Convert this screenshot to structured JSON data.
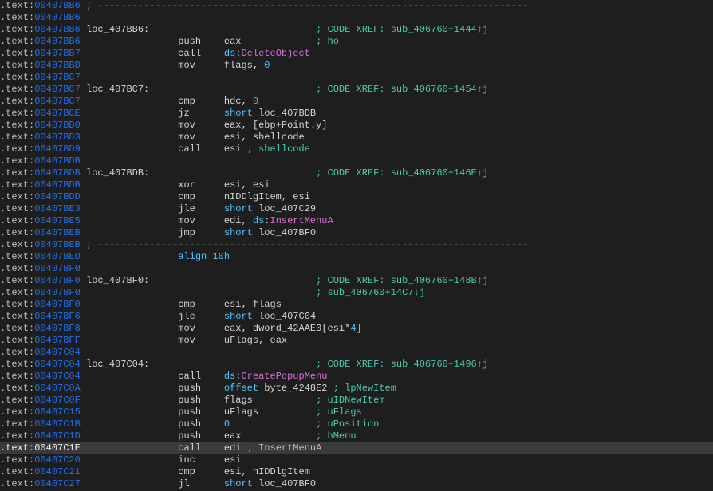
{
  "lines": [
    {
      "addr": "00407BB6",
      "segs": [
        {
          "c": "sep",
          "t": " ; ---------------------------------------------------------------------------"
        }
      ]
    },
    {
      "addr": "00407BB6",
      "segs": []
    },
    {
      "addr": "00407BB6",
      "segs": [
        {
          "c": "label",
          "t": " loc_407BB6"
        },
        {
          "c": "label",
          "t": ":"
        },
        {
          "c": "ident",
          "t": "                             "
        },
        {
          "c": "comment",
          "t": "; CODE XREF: sub_406760+1444"
        },
        {
          "c": "arrow",
          "t": "↑j"
        }
      ]
    },
    {
      "addr": "00407BB6",
      "segs": [
        {
          "c": "ident",
          "t": "                 "
        },
        {
          "c": "mnemonic",
          "t": "push"
        },
        {
          "c": "ident",
          "t": "    "
        },
        {
          "c": "reg",
          "t": "eax"
        },
        {
          "c": "ident",
          "t": "             "
        },
        {
          "c": "comment",
          "t": "; ho"
        }
      ]
    },
    {
      "addr": "00407BB7",
      "segs": [
        {
          "c": "ident",
          "t": "                 "
        },
        {
          "c": "mnemonic",
          "t": "call"
        },
        {
          "c": "ident",
          "t": "    "
        },
        {
          "c": "keyword",
          "t": "ds"
        },
        {
          "c": "ident",
          "t": ":"
        },
        {
          "c": "func",
          "t": "DeleteObject"
        }
      ]
    },
    {
      "addr": "00407BBD",
      "segs": [
        {
          "c": "ident",
          "t": "                 "
        },
        {
          "c": "mnemonic",
          "t": "mov"
        },
        {
          "c": "ident",
          "t": "     "
        },
        {
          "c": "ident",
          "t": "flags"
        },
        {
          "c": "ident",
          "t": ", "
        },
        {
          "c": "number",
          "t": "0"
        }
      ]
    },
    {
      "addr": "00407BC7",
      "segs": []
    },
    {
      "addr": "00407BC7",
      "segs": [
        {
          "c": "label",
          "t": " loc_407BC7"
        },
        {
          "c": "label",
          "t": ":"
        },
        {
          "c": "ident",
          "t": "                             "
        },
        {
          "c": "comment",
          "t": "; CODE XREF: sub_406760+1454"
        },
        {
          "c": "arrow",
          "t": "↑j"
        }
      ]
    },
    {
      "addr": "00407BC7",
      "segs": [
        {
          "c": "ident",
          "t": "                 "
        },
        {
          "c": "mnemonic",
          "t": "cmp"
        },
        {
          "c": "ident",
          "t": "     "
        },
        {
          "c": "ident",
          "t": "hdc"
        },
        {
          "c": "ident",
          "t": ", "
        },
        {
          "c": "number",
          "t": "0"
        }
      ]
    },
    {
      "addr": "00407BCE",
      "segs": [
        {
          "c": "ident",
          "t": "                 "
        },
        {
          "c": "mnemonic",
          "t": "jz"
        },
        {
          "c": "ident",
          "t": "      "
        },
        {
          "c": "short",
          "t": "short"
        },
        {
          "c": "ident",
          "t": " loc_407BDB"
        }
      ]
    },
    {
      "addr": "00407BD0",
      "segs": [
        {
          "c": "ident",
          "t": "                 "
        },
        {
          "c": "mnemonic",
          "t": "mov"
        },
        {
          "c": "ident",
          "t": "     "
        },
        {
          "c": "reg",
          "t": "eax"
        },
        {
          "c": "ident",
          "t": ", "
        },
        {
          "c": "ident",
          "t": "["
        },
        {
          "c": "reg",
          "t": "ebp"
        },
        {
          "c": "ident",
          "t": "+"
        },
        {
          "c": "ident",
          "t": "Point.y"
        },
        {
          "c": "ident",
          "t": "]"
        }
      ]
    },
    {
      "addr": "00407BD3",
      "segs": [
        {
          "c": "ident",
          "t": "                 "
        },
        {
          "c": "mnemonic",
          "t": "mov"
        },
        {
          "c": "ident",
          "t": "     "
        },
        {
          "c": "reg",
          "t": "esi"
        },
        {
          "c": "ident",
          "t": ", "
        },
        {
          "c": "ident",
          "t": "shellcode"
        }
      ]
    },
    {
      "addr": "00407BD9",
      "segs": [
        {
          "c": "ident",
          "t": "                 "
        },
        {
          "c": "mnemonic",
          "t": "call"
        },
        {
          "c": "ident",
          "t": "    "
        },
        {
          "c": "reg",
          "t": "esi"
        },
        {
          "c": "ident",
          "t": " "
        },
        {
          "c": "comment",
          "t": "; shellcode"
        }
      ]
    },
    {
      "addr": "00407BDB",
      "segs": []
    },
    {
      "addr": "00407BDB",
      "segs": [
        {
          "c": "label",
          "t": " loc_407BDB"
        },
        {
          "c": "label",
          "t": ":"
        },
        {
          "c": "ident",
          "t": "                             "
        },
        {
          "c": "comment",
          "t": "; CODE XREF: sub_406760+146E"
        },
        {
          "c": "arrow",
          "t": "↑j"
        }
      ]
    },
    {
      "addr": "00407BDB",
      "segs": [
        {
          "c": "ident",
          "t": "                 "
        },
        {
          "c": "mnemonic",
          "t": "xor"
        },
        {
          "c": "ident",
          "t": "     "
        },
        {
          "c": "reg",
          "t": "esi"
        },
        {
          "c": "ident",
          "t": ", "
        },
        {
          "c": "reg",
          "t": "esi"
        }
      ]
    },
    {
      "addr": "00407BDD",
      "segs": [
        {
          "c": "ident",
          "t": "                 "
        },
        {
          "c": "mnemonic",
          "t": "cmp"
        },
        {
          "c": "ident",
          "t": "     "
        },
        {
          "c": "ident",
          "t": "nIDDlgItem"
        },
        {
          "c": "ident",
          "t": ", "
        },
        {
          "c": "reg",
          "t": "esi"
        }
      ]
    },
    {
      "addr": "00407BE3",
      "segs": [
        {
          "c": "ident",
          "t": "                 "
        },
        {
          "c": "mnemonic",
          "t": "jle"
        },
        {
          "c": "ident",
          "t": "     "
        },
        {
          "c": "short",
          "t": "short"
        },
        {
          "c": "ident",
          "t": " loc_407C29"
        }
      ]
    },
    {
      "addr": "00407BE5",
      "segs": [
        {
          "c": "ident",
          "t": "                 "
        },
        {
          "c": "mnemonic",
          "t": "mov"
        },
        {
          "c": "ident",
          "t": "     "
        },
        {
          "c": "reg",
          "t": "edi"
        },
        {
          "c": "ident",
          "t": ", "
        },
        {
          "c": "keyword",
          "t": "ds"
        },
        {
          "c": "ident",
          "t": ":"
        },
        {
          "c": "func",
          "t": "InsertMenuA"
        }
      ]
    },
    {
      "addr": "00407BEB",
      "segs": [
        {
          "c": "ident",
          "t": "                 "
        },
        {
          "c": "mnemonic",
          "t": "jmp"
        },
        {
          "c": "ident",
          "t": "     "
        },
        {
          "c": "short",
          "t": "short"
        },
        {
          "c": "ident",
          "t": " loc_407BF0"
        }
      ]
    },
    {
      "addr": "00407BEB",
      "segs": [
        {
          "c": "sep",
          "t": " ; ---------------------------------------------------------------------------"
        }
      ]
    },
    {
      "addr": "00407BED",
      "segs": [
        {
          "c": "ident",
          "t": "                 "
        },
        {
          "c": "keyword",
          "t": "align "
        },
        {
          "c": "number",
          "t": "10h"
        }
      ]
    },
    {
      "addr": "00407BF0",
      "segs": []
    },
    {
      "addr": "00407BF0",
      "segs": [
        {
          "c": "label",
          "t": " loc_407BF0"
        },
        {
          "c": "label",
          "t": ":"
        },
        {
          "c": "ident",
          "t": "                             "
        },
        {
          "c": "comment",
          "t": "; CODE XREF: sub_406760+148B"
        },
        {
          "c": "arrow",
          "t": "↑j"
        }
      ]
    },
    {
      "addr": "00407BF0",
      "segs": [
        {
          "c": "ident",
          "t": "                                         "
        },
        {
          "c": "comment",
          "t": "; sub_406760+14C7"
        },
        {
          "c": "arrow",
          "t": "↓j"
        }
      ]
    },
    {
      "addr": "00407BF0",
      "segs": [
        {
          "c": "ident",
          "t": "                 "
        },
        {
          "c": "mnemonic",
          "t": "cmp"
        },
        {
          "c": "ident",
          "t": "     "
        },
        {
          "c": "reg",
          "t": "esi"
        },
        {
          "c": "ident",
          "t": ", "
        },
        {
          "c": "ident",
          "t": "flags"
        }
      ]
    },
    {
      "addr": "00407BF6",
      "segs": [
        {
          "c": "ident",
          "t": "                 "
        },
        {
          "c": "mnemonic",
          "t": "jle"
        },
        {
          "c": "ident",
          "t": "     "
        },
        {
          "c": "short",
          "t": "short"
        },
        {
          "c": "ident",
          "t": " loc_407C04"
        }
      ]
    },
    {
      "addr": "00407BF8",
      "segs": [
        {
          "c": "ident",
          "t": "                 "
        },
        {
          "c": "mnemonic",
          "t": "mov"
        },
        {
          "c": "ident",
          "t": "     "
        },
        {
          "c": "reg",
          "t": "eax"
        },
        {
          "c": "ident",
          "t": ", "
        },
        {
          "c": "ident",
          "t": "dword_42AAE0"
        },
        {
          "c": "ident",
          "t": "["
        },
        {
          "c": "reg",
          "t": "esi"
        },
        {
          "c": "ident",
          "t": "*"
        },
        {
          "c": "number",
          "t": "4"
        },
        {
          "c": "ident",
          "t": "]"
        }
      ]
    },
    {
      "addr": "00407BFF",
      "segs": [
        {
          "c": "ident",
          "t": "                 "
        },
        {
          "c": "mnemonic",
          "t": "mov"
        },
        {
          "c": "ident",
          "t": "     "
        },
        {
          "c": "ident",
          "t": "uFlags"
        },
        {
          "c": "ident",
          "t": ", "
        },
        {
          "c": "reg",
          "t": "eax"
        }
      ]
    },
    {
      "addr": "00407C04",
      "segs": []
    },
    {
      "addr": "00407C04",
      "segs": [
        {
          "c": "label",
          "t": " loc_407C04"
        },
        {
          "c": "label",
          "t": ":"
        },
        {
          "c": "ident",
          "t": "                             "
        },
        {
          "c": "comment",
          "t": "; CODE XREF: sub_406760+1496"
        },
        {
          "c": "arrow",
          "t": "↑j"
        }
      ]
    },
    {
      "addr": "00407C04",
      "segs": [
        {
          "c": "ident",
          "t": "                 "
        },
        {
          "c": "mnemonic",
          "t": "call"
        },
        {
          "c": "ident",
          "t": "    "
        },
        {
          "c": "keyword",
          "t": "ds"
        },
        {
          "c": "ident",
          "t": ":"
        },
        {
          "c": "func",
          "t": "CreatePopupMenu"
        }
      ]
    },
    {
      "addr": "00407C0A",
      "segs": [
        {
          "c": "ident",
          "t": "                 "
        },
        {
          "c": "mnemonic",
          "t": "push"
        },
        {
          "c": "ident",
          "t": "    "
        },
        {
          "c": "offset",
          "t": "offset "
        },
        {
          "c": "byteid",
          "t": "byte_4248E2"
        },
        {
          "c": "ident",
          "t": " "
        },
        {
          "c": "comment",
          "t": "; lpNewItem"
        }
      ]
    },
    {
      "addr": "00407C0F",
      "segs": [
        {
          "c": "ident",
          "t": "                 "
        },
        {
          "c": "mnemonic",
          "t": "push"
        },
        {
          "c": "ident",
          "t": "    "
        },
        {
          "c": "ident",
          "t": "flags"
        },
        {
          "c": "ident",
          "t": "           "
        },
        {
          "c": "comment",
          "t": "; uIDNewItem"
        }
      ]
    },
    {
      "addr": "00407C15",
      "segs": [
        {
          "c": "ident",
          "t": "                 "
        },
        {
          "c": "mnemonic",
          "t": "push"
        },
        {
          "c": "ident",
          "t": "    "
        },
        {
          "c": "ident",
          "t": "uFlags"
        },
        {
          "c": "ident",
          "t": "          "
        },
        {
          "c": "comment",
          "t": "; uFlags"
        }
      ]
    },
    {
      "addr": "00407C1B",
      "segs": [
        {
          "c": "ident",
          "t": "                 "
        },
        {
          "c": "mnemonic",
          "t": "push"
        },
        {
          "c": "ident",
          "t": "    "
        },
        {
          "c": "number",
          "t": "0"
        },
        {
          "c": "ident",
          "t": "               "
        },
        {
          "c": "comment",
          "t": "; uPosition"
        }
      ]
    },
    {
      "addr": "00407C1D",
      "segs": [
        {
          "c": "ident",
          "t": "                 "
        },
        {
          "c": "mnemonic",
          "t": "push"
        },
        {
          "c": "ident",
          "t": "    "
        },
        {
          "c": "reg",
          "t": "eax"
        },
        {
          "c": "ident",
          "t": "             "
        },
        {
          "c": "comment",
          "t": "; hMenu"
        }
      ]
    },
    {
      "addr": "00407C1E",
      "highlighted": true,
      "segs": [
        {
          "c": "ident",
          "t": "                 "
        },
        {
          "c": "mnemonic",
          "t": "call"
        },
        {
          "c": "ident",
          "t": "    "
        },
        {
          "c": "reg",
          "t": "edi"
        },
        {
          "c": "ident",
          "t": " "
        },
        {
          "c": "comment",
          "t": ";"
        },
        {
          "c": "ident",
          "t": " "
        },
        {
          "c": "func-lite",
          "t": "InsertMenuA"
        }
      ]
    },
    {
      "addr": "00407C20",
      "segs": [
        {
          "c": "ident",
          "t": "                 "
        },
        {
          "c": "mnemonic",
          "t": "inc"
        },
        {
          "c": "ident",
          "t": "     "
        },
        {
          "c": "reg",
          "t": "esi"
        }
      ]
    },
    {
      "addr": "00407C21",
      "segs": [
        {
          "c": "ident",
          "t": "                 "
        },
        {
          "c": "mnemonic",
          "t": "cmp"
        },
        {
          "c": "ident",
          "t": "     "
        },
        {
          "c": "reg",
          "t": "esi"
        },
        {
          "c": "ident",
          "t": ", "
        },
        {
          "c": "ident",
          "t": "nIDDlgItem"
        }
      ]
    },
    {
      "addr": "00407C27",
      "segs": [
        {
          "c": "ident",
          "t": "                 "
        },
        {
          "c": "mnemonic",
          "t": "jl"
        },
        {
          "c": "ident",
          "t": "      "
        },
        {
          "c": "short",
          "t": "short"
        },
        {
          "c": "ident",
          "t": " loc_407BF0"
        }
      ]
    }
  ],
  "addr_prefix": ".text:"
}
